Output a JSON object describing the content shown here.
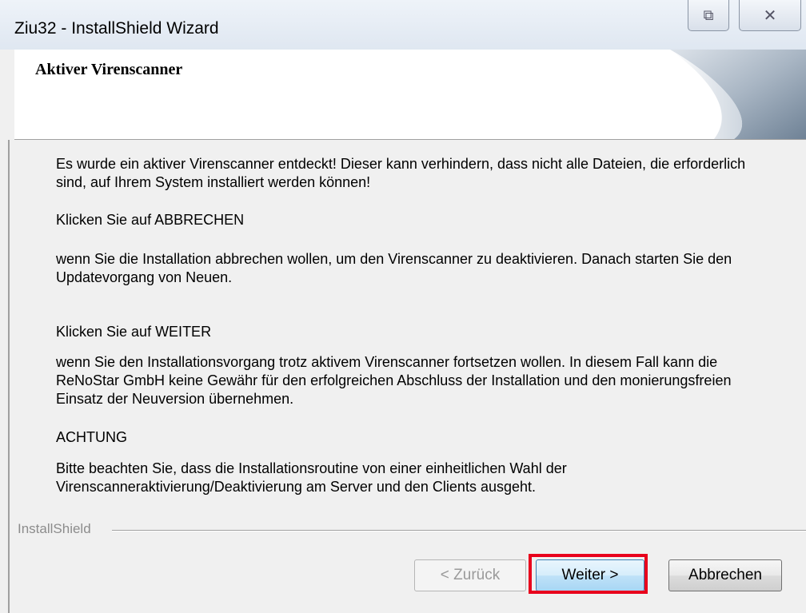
{
  "window": {
    "title": "Ziu32 - InstallShield Wizard",
    "restore_glyph": "⧉",
    "close_glyph": "✕"
  },
  "header": {
    "title": "Aktiver Virenscanner"
  },
  "content": {
    "p1": "Es wurde ein aktiver Virenscanner entdeckt! Dieser kann verhindern, dass nicht alle Dateien, die erforderlich sind, auf Ihrem System installiert werden können!",
    "p2": "Klicken Sie auf ABBRECHEN",
    "p3": "wenn Sie die Installation abbrechen wollen, um den Virenscanner zu deaktivieren. Danach starten Sie den Updatevorgang von Neuen.",
    "p4": "Klicken Sie auf WEITER",
    "p5": "wenn Sie den Installationsvorgang trotz aktivem Virenscanner fortsetzen wollen. In diesem Fall kann die ReNoStar GmbH keine Gewähr für den erfolgreichen Abschluss der Installation und den monierungsfreien Einsatz der Neuversion übernehmen.",
    "p6": "ACHTUNG",
    "p7": "Bitte beachten Sie, dass die Installationsroutine von einer einheitlichen Wahl der Virenscanneraktivierung/Deaktivierung am Server und den Clients ausgeht."
  },
  "footer": {
    "brand": "InstallShield",
    "back_label": "< Zurück",
    "next_label": "Weiter >",
    "cancel_label": "Abbrechen"
  },
  "colors": {
    "highlight": "#e8001c"
  }
}
